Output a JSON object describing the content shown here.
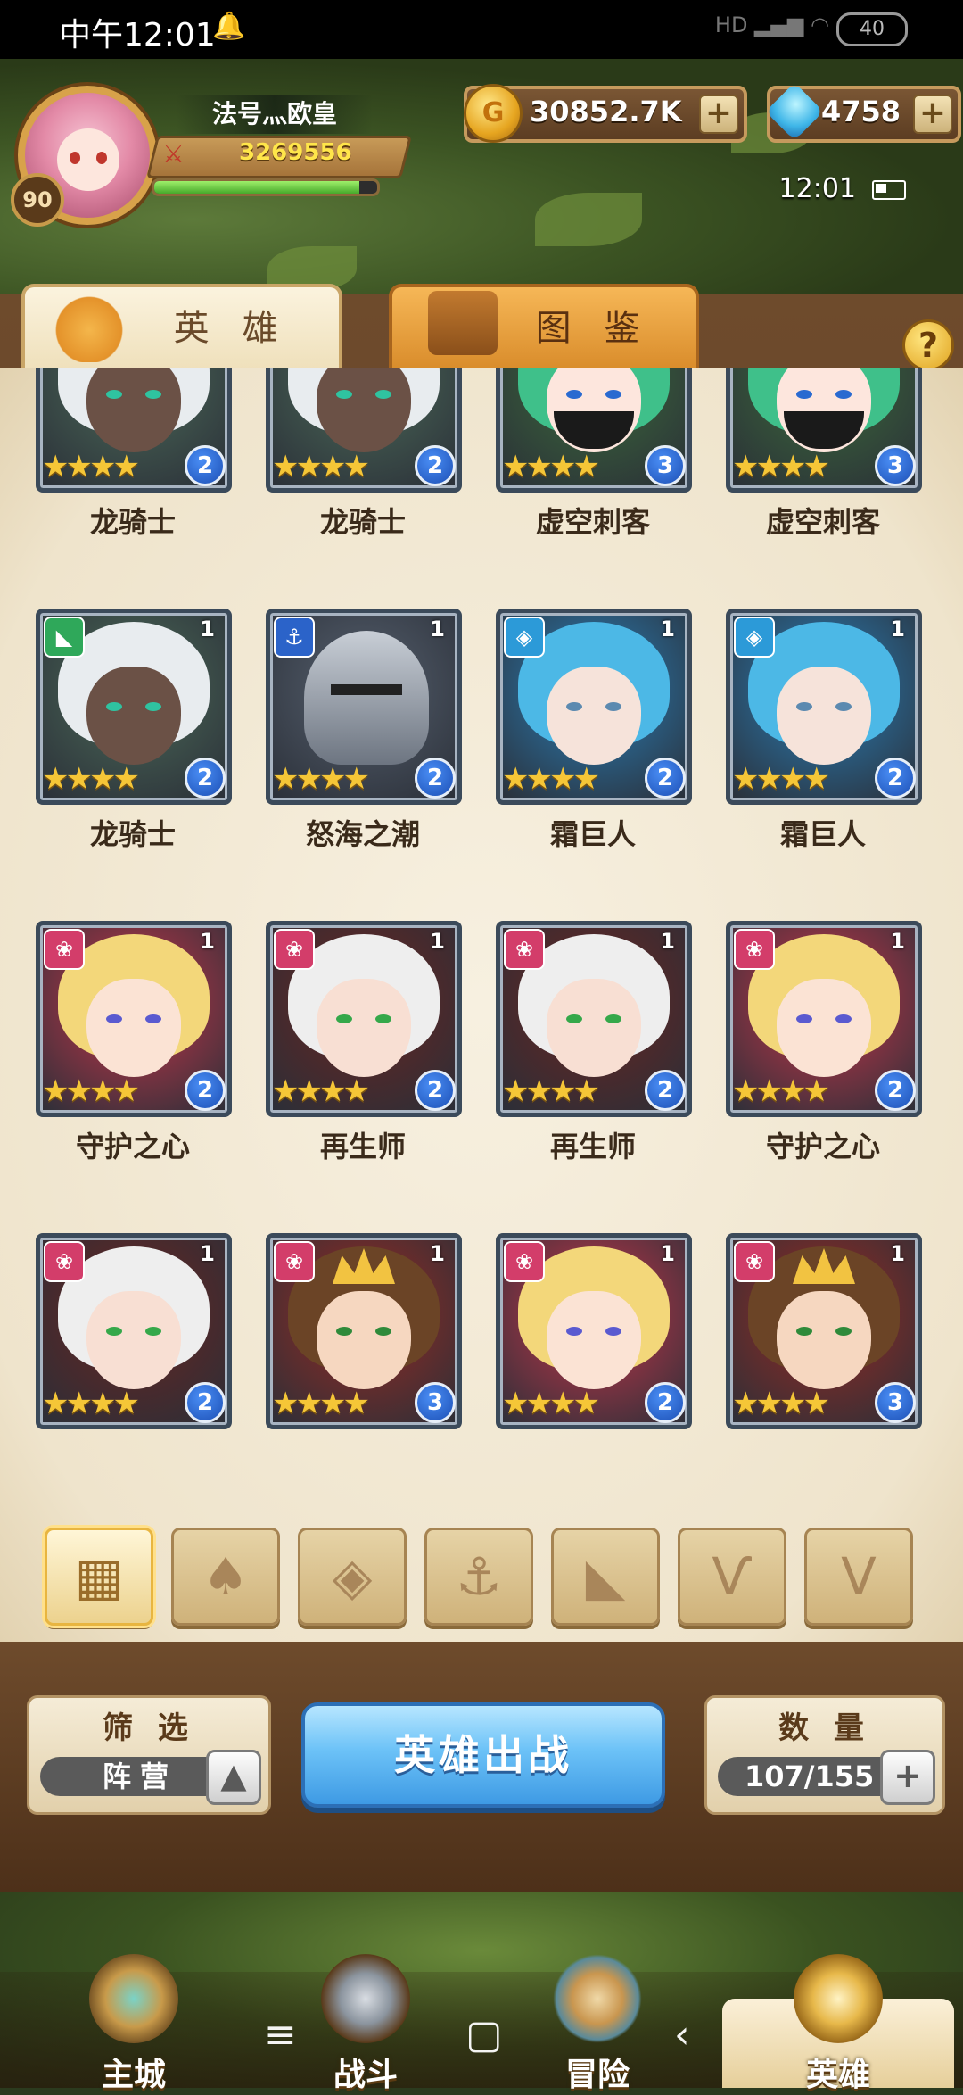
{
  "status_bar": {
    "time": "中午12:01",
    "signal_text": "HD",
    "battery": "40"
  },
  "player": {
    "name": "法号灬欧皇",
    "level": "90",
    "power": "3269556",
    "exp_fraction": 0.92
  },
  "currency": {
    "gold": "30852.7K",
    "gems": "4758"
  },
  "game_clock": "12:01",
  "tabs": [
    {
      "label": "英 雄",
      "active": true
    },
    {
      "label": "图 鉴",
      "active": false
    }
  ],
  "heroes": [
    {
      "name": "龙骑士",
      "stars": 4,
      "level": "2",
      "copies": "",
      "faction": "beast"
    },
    {
      "name": "龙骑士",
      "stars": 4,
      "level": "2",
      "copies": "",
      "faction": "beast"
    },
    {
      "name": "虚空刺客",
      "stars": 4,
      "level": "3",
      "copies": "",
      "faction": "beast"
    },
    {
      "name": "虚空刺客",
      "stars": 4,
      "level": "3",
      "copies": "",
      "faction": "beast"
    },
    {
      "name": "龙骑士",
      "stars": 4,
      "level": "2",
      "copies": "1",
      "faction": "beast"
    },
    {
      "name": "怒海之潮",
      "stars": 4,
      "level": "2",
      "copies": "1",
      "faction": "anchor"
    },
    {
      "name": "霜巨人",
      "stars": 4,
      "level": "2",
      "copies": "1",
      "faction": "rune"
    },
    {
      "name": "霜巨人",
      "stars": 4,
      "level": "2",
      "copies": "1",
      "faction": "rune"
    },
    {
      "name": "守护之心",
      "stars": 4,
      "level": "2",
      "copies": "1",
      "faction": "lotus"
    },
    {
      "name": "再生师",
      "stars": 4,
      "level": "2",
      "copies": "1",
      "faction": "lotus"
    },
    {
      "name": "再生师",
      "stars": 4,
      "level": "2",
      "copies": "1",
      "faction": "lotus"
    },
    {
      "name": "守护之心",
      "stars": 4,
      "level": "2",
      "copies": "1",
      "faction": "lotus"
    },
    {
      "name": "",
      "stars": 4,
      "level": "2",
      "copies": "1",
      "faction": "lotus"
    },
    {
      "name": "",
      "stars": 4,
      "level": "3",
      "copies": "1",
      "faction": "lotus"
    },
    {
      "name": "",
      "stars": 4,
      "level": "2",
      "copies": "1",
      "faction": "lotus"
    },
    {
      "name": "",
      "stars": 4,
      "level": "3",
      "copies": "1",
      "faction": "lotus"
    }
  ],
  "faction_filters": [
    "all-grid-icon",
    "lotus-icon",
    "rune-icon",
    "anchor-icon",
    "beast-icon",
    "horns-icon",
    "wings-icon"
  ],
  "controls": {
    "filter_title": "筛 选",
    "filter_value": "阵营",
    "filter_toggle": "▲",
    "deploy_label": "英雄出战",
    "count_title": "数 量",
    "count_value": "107/155",
    "count_plus": "+"
  },
  "nav": [
    {
      "label": "主城",
      "active": false
    },
    {
      "label": "战斗",
      "active": false
    },
    {
      "label": "冒险",
      "active": false
    },
    {
      "label": "英雄",
      "active": true
    }
  ],
  "system_keys": {
    "menu": "≡",
    "home": "▢",
    "back": "‹"
  },
  "colors": {
    "accent_blue": "#3e9ae4",
    "gold": "#f5c637",
    "parchment": "#f4ecda"
  }
}
